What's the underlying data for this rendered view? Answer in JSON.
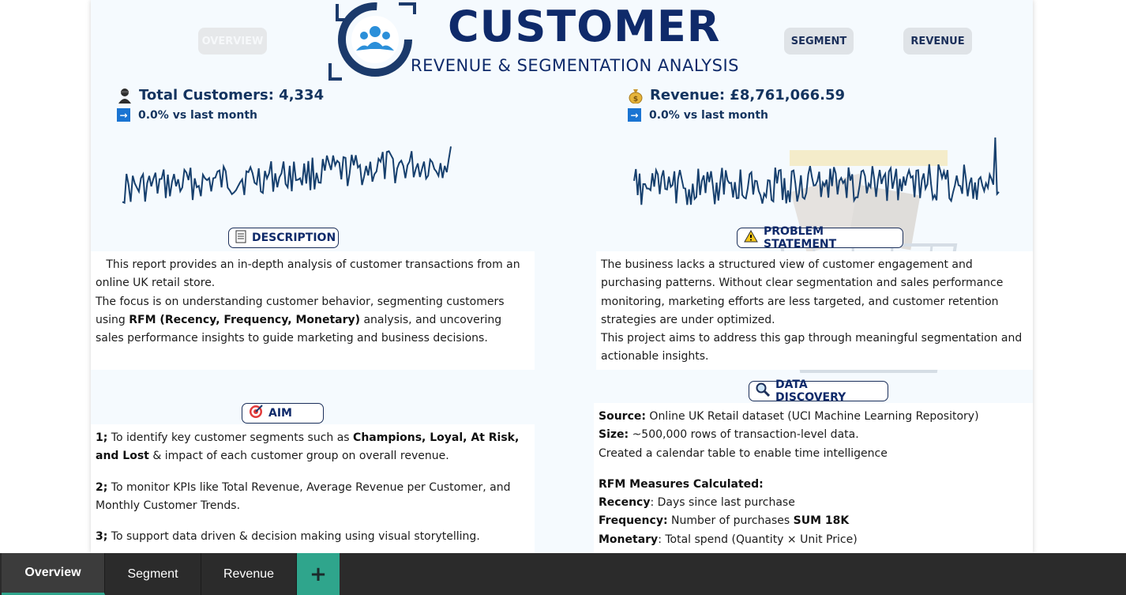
{
  "nav": {
    "overview": "OVERVIEW",
    "segment": "SEGMENT",
    "revenue": "REVENUE"
  },
  "header": {
    "title": "CUSTOMER",
    "subtitle": "REVENUE & SEGMENTATION ANALYSIS",
    "logo_icon": "customers-group-icon"
  },
  "kpis": {
    "customers": {
      "label": "Total Customers: 4,334",
      "change": "0.0% vs last month",
      "icon": "person-icon"
    },
    "revenue": {
      "label": "Revenue: £8,761,066.59",
      "change": "0.0% vs last month",
      "icon": "money-bag-icon"
    }
  },
  "sections": {
    "description": {
      "title": "DESCRIPTION",
      "p1": "This report provides an in-depth analysis of customer transactions from an online UK retail store.",
      "p2_pre": "The focus is on understanding customer behavior, segmenting customers using ",
      "p2_bold": "RFM (Recency, Frequency, Monetary)",
      "p2_post": " analysis, and uncovering sales performance insights to guide marketing and business decisions."
    },
    "problem": {
      "title": "PROBLEM STATEMENT",
      "p1": "The business lacks a structured view of customer engagement and purchasing patterns. Without clear segmentation and sales performance monitoring, marketing efforts are less targeted, and customer retention strategies are under optimized.",
      "p2": "This project aims to address this gap through meaningful segmentation and actionable insights."
    },
    "aim": {
      "title": "AIM",
      "i1_num": "1;",
      "i1_pre": " To identify key customer segments such as ",
      "i1_bold": "Champions, Loyal, At Risk, and Lost",
      "i1_post": " & impact of each customer group on overall revenue.",
      "i2_num": "2;",
      "i2_text": " To monitor KPIs like Total Revenue, Average Revenue per Customer, and Monthly Customer Trends.",
      "i3_num": "3;",
      "i3_text": " To support data driven & decision making using visual storytelling."
    },
    "discovery": {
      "title": "DATA DISCOVERY",
      "source_label": "Source:",
      "source_text": " Online UK Retail dataset (UCI Machine Learning Repository)",
      "size_label": "Size:",
      "size_text": " ~500,000 rows of transaction-level data.",
      "calendar": "Created a calendar table to enable time intelligence",
      "rfm_title": "RFM Measures Calculated:",
      "recency_label": "Recency",
      "recency_text": ": Days since last purchase",
      "frequency_label": "Frequency:",
      "frequency_text": " Number of purchases ",
      "frequency_bold": "SUM 18K",
      "monetary_label": "Monetary",
      "monetary_text": ": Total spend (Quantity × Unit Price)"
    }
  },
  "tabs": {
    "overview": "Overview",
    "segment": "Segment",
    "revenue": "Revenue",
    "add": "+"
  },
  "colors": {
    "title": "#0f2a6a",
    "spark_line": "#17406e",
    "tab_accent": "#2fa58c",
    "tab_bar": "#2b2b2b"
  }
}
